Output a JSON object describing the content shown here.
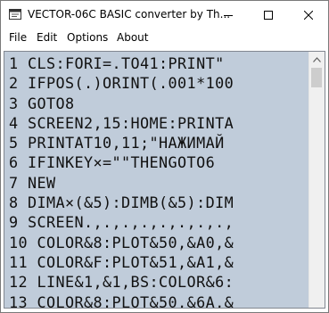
{
  "window": {
    "title": "VECTOR-06C BASIC converter by Th..."
  },
  "menu": {
    "items": [
      "File",
      "Edit",
      "Options",
      "About"
    ]
  },
  "editor": {
    "lines": [
      "1 CLS:FORI=.TO41:PRINT\"",
      "2 IFPOS(.)ORINT(.001*100",
      "3 GOTO8",
      "4 SCREEN2,15:HOME:PRINTA",
      "5 PRINTAT10,11;\"НАЖИМАЙ",
      "6 IFINKEY×=\"\"THENGOTO6",
      "7 NEW",
      "8 DIMA×(&5):DIMB(&5):DIM",
      "9 SCREEN.,.,.,.,.,.,.,.,",
      "10 COLOR&8:PLOT&50,&A0,&",
      "11 COLOR&F:PLOT&51,&A1,&",
      "12 LINE&1,&1,BS:COLOR&6:",
      "13 COLOR&8:PLOT&50,&6A,&"
    ]
  },
  "colors": {
    "editor_background": "#c0ccda",
    "scrollbar_track": "#f0f0f0",
    "scrollbar_thumb": "#cdcdcd"
  },
  "icons": {
    "app": "app-window-icon",
    "minimize": "minimize-icon",
    "maximize": "maximize-icon",
    "close": "close-icon",
    "scroll_up": "scroll-up-arrow-icon"
  }
}
